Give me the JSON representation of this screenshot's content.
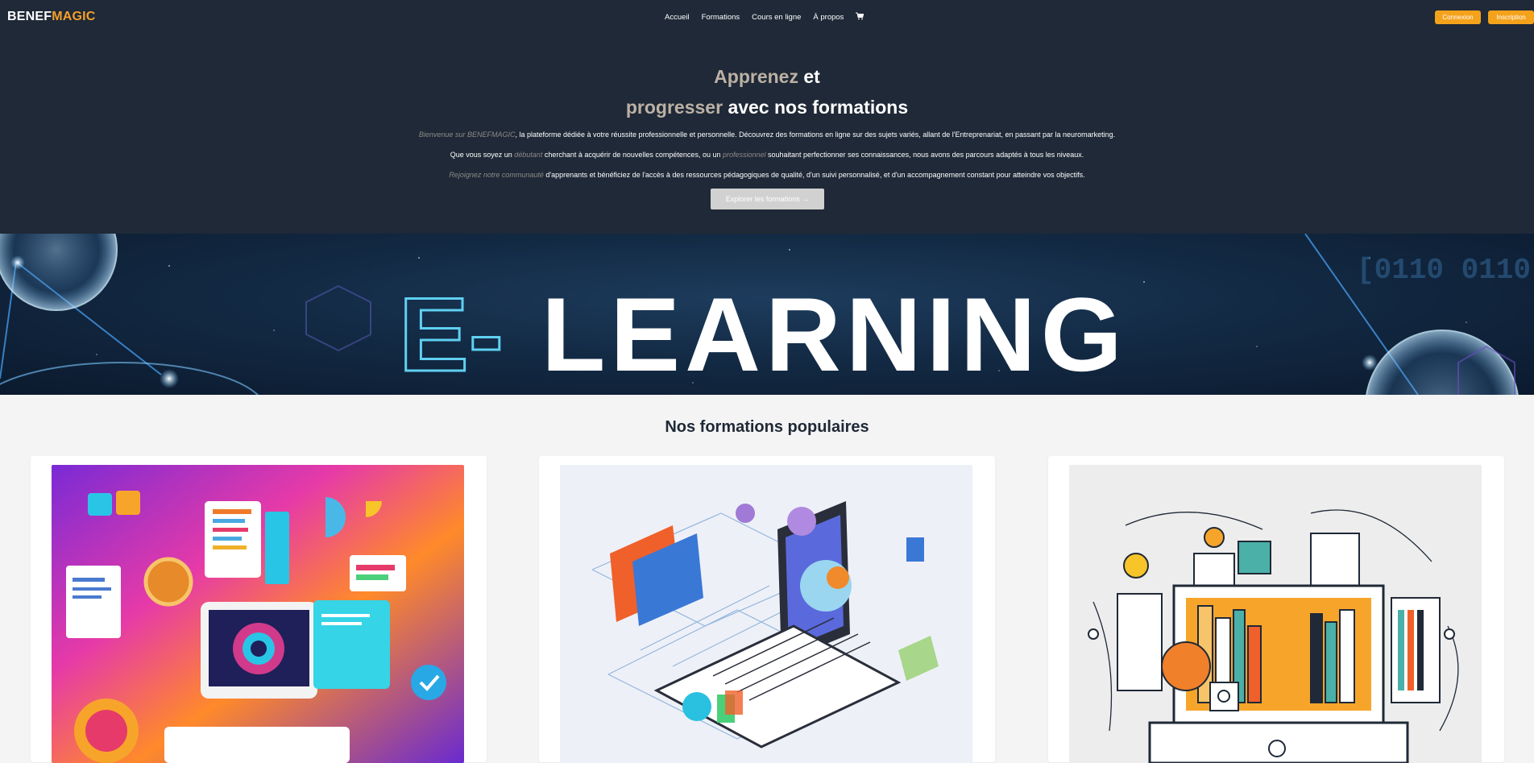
{
  "brand": {
    "part1": "BENEF",
    "part2": "MAGIC",
    "accent_color": "#f4a02a"
  },
  "nav": {
    "items": [
      "Accueil",
      "Formations",
      "Cours en ligne",
      "À propos"
    ],
    "cart_icon": "cart-icon"
  },
  "auth": {
    "login_label": "Connexion",
    "signup_label": "Inscription"
  },
  "hero": {
    "title_line1_a": "Apprenez",
    "title_line1_b": "et",
    "title_line2_a": "progresser",
    "title_line2_b": "avec nos formations",
    "p1_em": "Bienvenue sur BENEFMAGIC",
    "p1_rest": ", la plateforme dédiée à votre réussite professionnelle et personnelle. Découvrez des formations en ligne sur des sujets variés, allant de l'Entreprenariat, en passant par la neuromarketing.",
    "p2_a": "Que vous soyez un ",
    "p2_em1": "débutant",
    "p2_b": " cherchant à acquérir de nouvelles compétences, ou un ",
    "p2_em2": "professionnel",
    "p2_c": " souhaitant perfectionner ses connaissances, nous avons des parcours adaptés à tous les niveaux.",
    "p3_em": "Rejoignez notre communauté",
    "p3_rest": " d'apprenants et bénéficiez de l'accès à des ressources pédagogiques de qualité, d'un suivi personnalisé, et d'un accompagnement constant pour atteindre vos objectifs.",
    "cta_label": "Explorer les formations →"
  },
  "banner": {
    "title_outline": "E-",
    "title_main": "LEARNING",
    "binary": "[0110 0110"
  },
  "popular": {
    "title": "Nos formations populaires"
  }
}
